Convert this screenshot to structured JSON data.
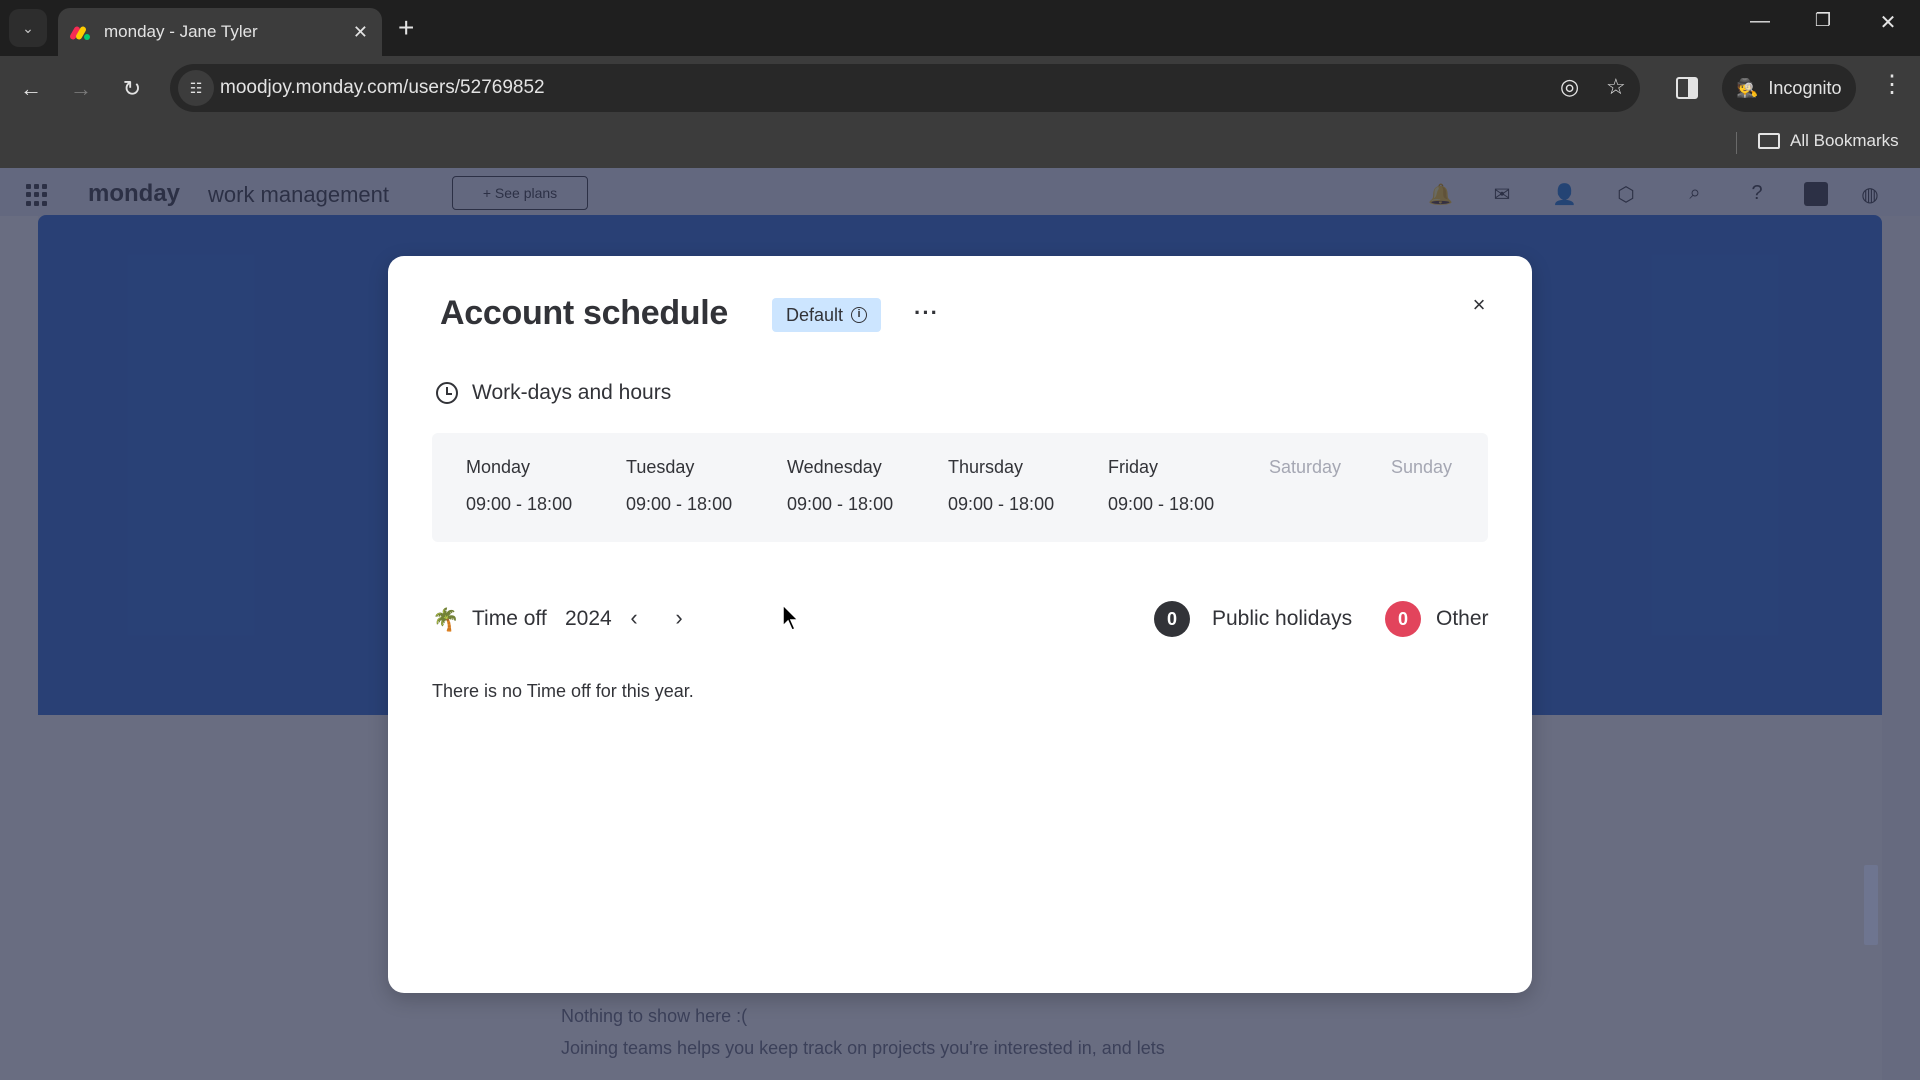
{
  "browser": {
    "tab_title": "monday - Jane Tyler",
    "url": "moodjoy.monday.com/users/52769852",
    "profile_label": "Incognito",
    "bookmarks_label": "All Bookmarks"
  },
  "app": {
    "logo": "monday",
    "product": "work management",
    "see_plans": "+ See plans",
    "empty_title": "Nothing to show here :(",
    "empty_desc": "Joining teams helps you keep track on projects you're interested in, and lets"
  },
  "modal": {
    "title": "Account schedule",
    "badge": "Default",
    "more": "···",
    "close": "×",
    "workdays_title": "Work-days and hours",
    "days": [
      {
        "name": "Monday",
        "hours": "09:00 - 18:00",
        "working": true
      },
      {
        "name": "Tuesday",
        "hours": "09:00 - 18:00",
        "working": true
      },
      {
        "name": "Wednesday",
        "hours": "09:00 - 18:00",
        "working": true
      },
      {
        "name": "Thursday",
        "hours": "09:00 - 18:00",
        "working": true
      },
      {
        "name": "Friday",
        "hours": "09:00 - 18:00",
        "working": true
      },
      {
        "name": "Saturday",
        "hours": "",
        "working": false
      },
      {
        "name": "Sunday",
        "hours": "",
        "working": false
      }
    ],
    "timeoff": {
      "label": "Time off",
      "year": "2024",
      "prev": "‹",
      "next": "›",
      "public_holidays_count": "0",
      "public_holidays_label": "Public holidays",
      "other_count": "0",
      "other_label": "Other",
      "empty_text": "There is no Time off for this year."
    }
  },
  "colors": {
    "public_holidays_badge": "#323338",
    "other_badge": "#e2445c",
    "default_badge_bg": "#cce5ff"
  }
}
